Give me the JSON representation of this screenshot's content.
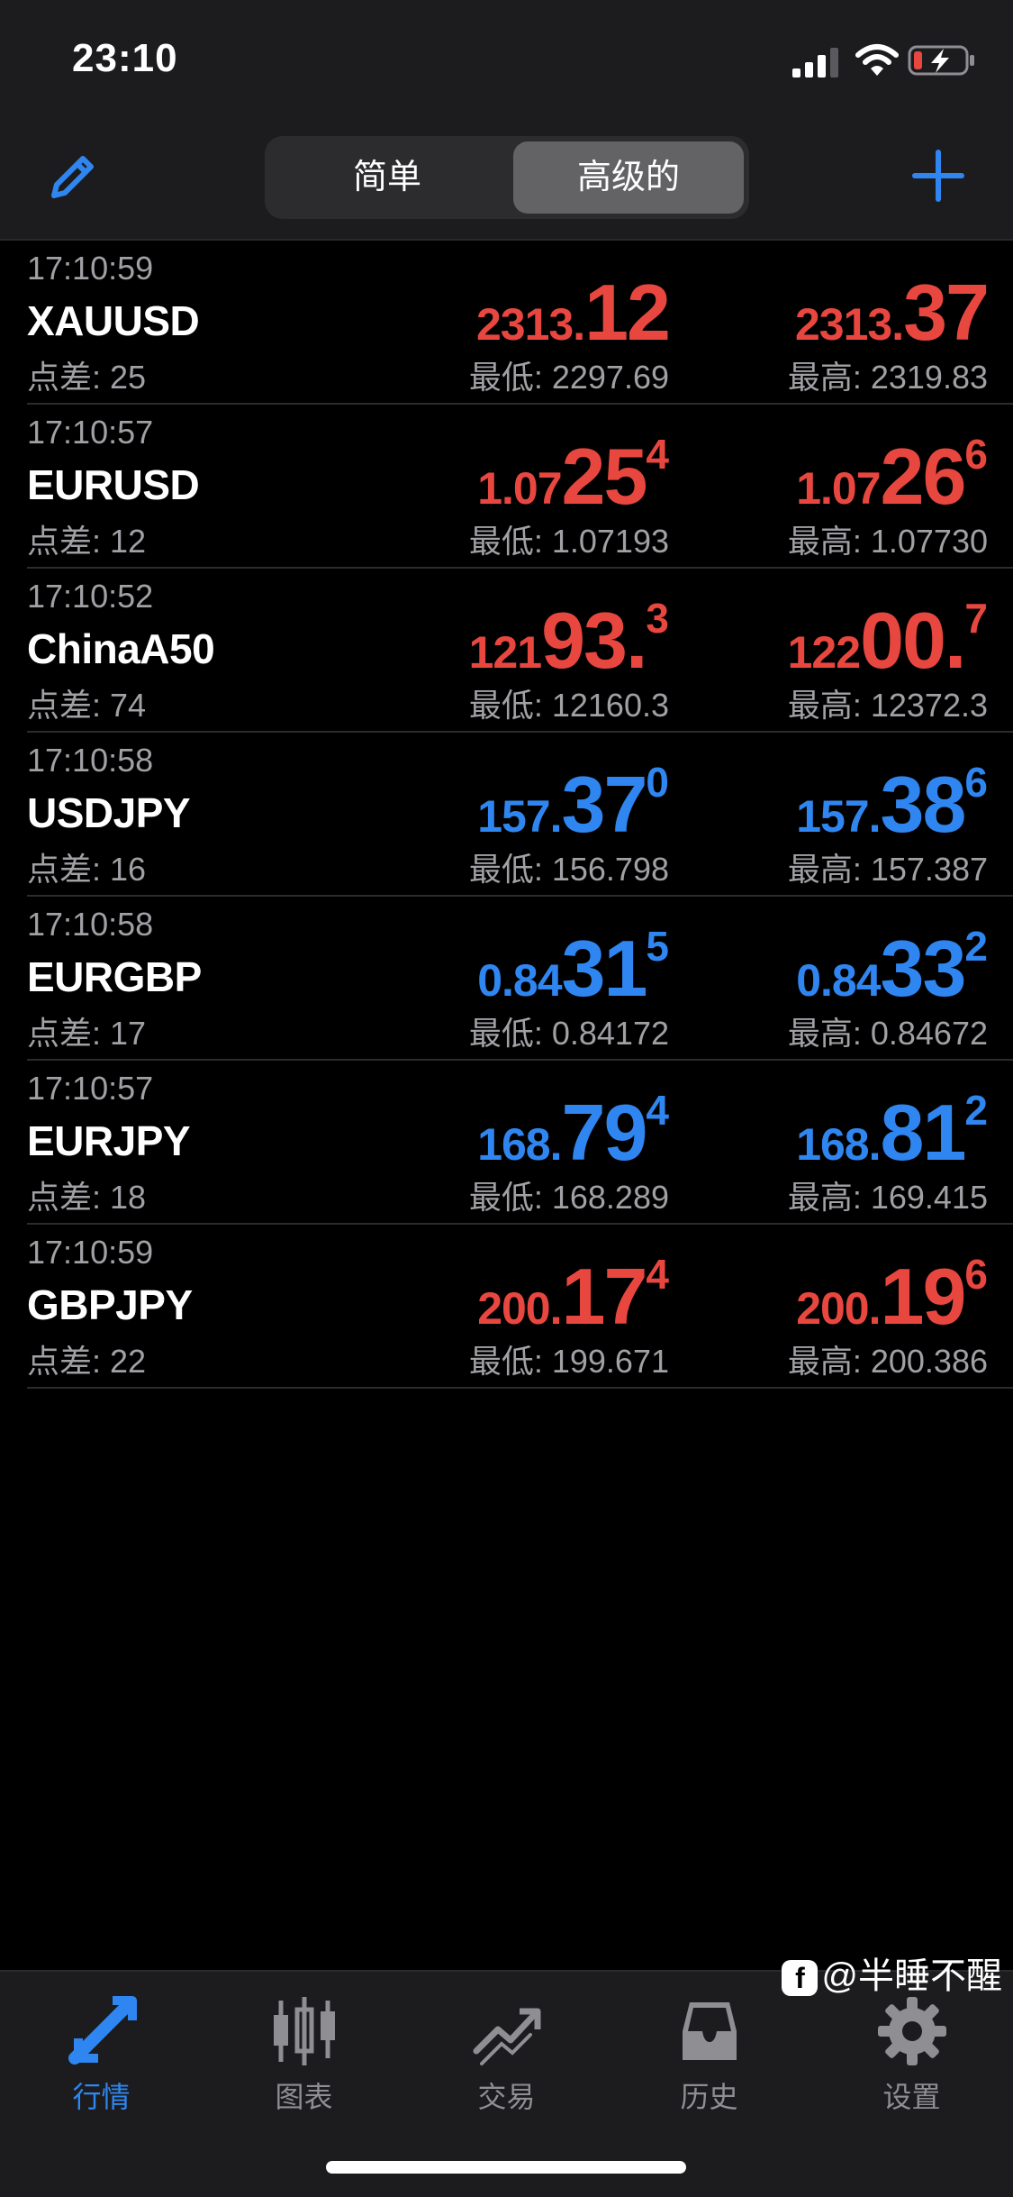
{
  "status_bar": {
    "time": "23:10"
  },
  "nav": {
    "segments": [
      "简单",
      "高级的"
    ],
    "active_segment": "高级的"
  },
  "quotes": [
    {
      "time": "17:10:59",
      "symbol": "XAUUSD",
      "spread_label": "点差: 25",
      "bid": {
        "small": "2313.",
        "big": "12",
        "sup": ""
      },
      "ask": {
        "small": "2313.",
        "big": "37",
        "sup": ""
      },
      "low_label": "最低: 2297.69",
      "high_label": "最高: 2319.83",
      "direction": "up"
    },
    {
      "time": "17:10:57",
      "symbol": "EURUSD",
      "spread_label": "点差: 12",
      "bid": {
        "small": "1.07",
        "big": "25",
        "sup": "4"
      },
      "ask": {
        "small": "1.07",
        "big": "26",
        "sup": "6"
      },
      "low_label": "最低: 1.07193",
      "high_label": "最高: 1.07730",
      "direction": "up"
    },
    {
      "time": "17:10:52",
      "symbol": "ChinaA50",
      "spread_label": "点差: 74",
      "bid": {
        "small": "121",
        "big": "93.",
        "sup": "3"
      },
      "ask": {
        "small": "122",
        "big": "00.",
        "sup": "7"
      },
      "low_label": "最低: 12160.3",
      "high_label": "最高: 12372.3",
      "direction": "up"
    },
    {
      "time": "17:10:58",
      "symbol": "USDJPY",
      "spread_label": "点差: 16",
      "bid": {
        "small": "157.",
        "big": "37",
        "sup": "0"
      },
      "ask": {
        "small": "157.",
        "big": "38",
        "sup": "6"
      },
      "low_label": "最低: 156.798",
      "high_label": "最高: 157.387",
      "direction": "down"
    },
    {
      "time": "17:10:58",
      "symbol": "EURGBP",
      "spread_label": "点差: 17",
      "bid": {
        "small": "0.84",
        "big": "31",
        "sup": "5"
      },
      "ask": {
        "small": "0.84",
        "big": "33",
        "sup": "2"
      },
      "low_label": "最低: 0.84172",
      "high_label": "最高: 0.84672",
      "direction": "down"
    },
    {
      "time": "17:10:57",
      "symbol": "EURJPY",
      "spread_label": "点差: 18",
      "bid": {
        "small": "168.",
        "big": "79",
        "sup": "4"
      },
      "ask": {
        "small": "168.",
        "big": "81",
        "sup": "2"
      },
      "low_label": "最低: 168.289",
      "high_label": "最高: 169.415",
      "direction": "down"
    },
    {
      "time": "17:10:59",
      "symbol": "GBPJPY",
      "spread_label": "点差: 22",
      "bid": {
        "small": "200.",
        "big": "17",
        "sup": "4"
      },
      "ask": {
        "small": "200.",
        "big": "19",
        "sup": "6"
      },
      "low_label": "最低: 199.671",
      "high_label": "最高: 200.386",
      "direction": "up"
    }
  ],
  "tabs": [
    {
      "label": "行情",
      "icon": "quotes-icon",
      "active": true
    },
    {
      "label": "图表",
      "icon": "chart-icon",
      "active": false
    },
    {
      "label": "交易",
      "icon": "trade-icon",
      "active": false
    },
    {
      "label": "历史",
      "icon": "history-icon",
      "active": false
    },
    {
      "label": "设置",
      "icon": "settings-icon",
      "active": false
    }
  ],
  "watermark": {
    "logo": "f",
    "text": "@半睡不醒"
  },
  "colors": {
    "up": "#e8473f",
    "down": "#2f86f0",
    "accent": "#2f86f0"
  }
}
